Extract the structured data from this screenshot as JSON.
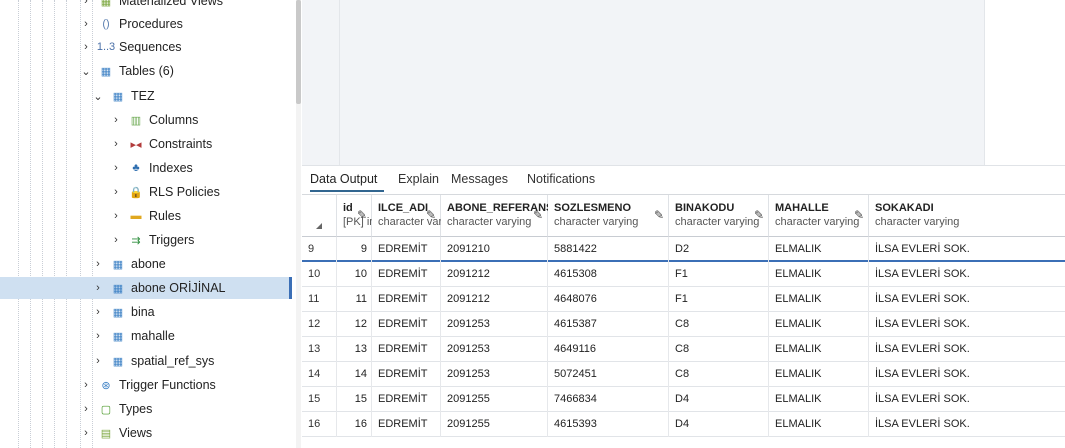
{
  "sidebar": {
    "items": [
      {
        "label": "Materialized Views",
        "chev": "›",
        "icon": "materialized-views-icon",
        "glyph": "▦",
        "color": "#7aa63c"
      },
      {
        "label": "Procedures",
        "chev": "›",
        "icon": "procedures-icon",
        "glyph": "()",
        "color": "#5b7fb0"
      },
      {
        "label": "Sequences",
        "chev": "›",
        "icon": "sequences-icon",
        "glyph": "1..3",
        "color": "#4a70a8"
      },
      {
        "label": "Tables (6)",
        "chev": "⌄",
        "icon": "tables-icon",
        "glyph": "▦",
        "color": "#3a7fc4"
      },
      {
        "label": "TEZ",
        "chev": "⌄",
        "icon": "table-icon",
        "glyph": "▦",
        "color": "#3a7fc4"
      },
      {
        "label": "Columns",
        "chev": "›",
        "icon": "columns-icon",
        "glyph": "▥",
        "color": "#6aa84f"
      },
      {
        "label": "Constraints",
        "chev": "›",
        "icon": "constraints-icon",
        "glyph": "▸◂",
        "color": "#b23b3b"
      },
      {
        "label": "Indexes",
        "chev": "›",
        "icon": "indexes-icon",
        "glyph": "♣",
        "color": "#2f6fb0"
      },
      {
        "label": "RLS Policies",
        "chev": "›",
        "icon": "rls-policies-icon",
        "glyph": "🔒",
        "color": "#4c9a2a"
      },
      {
        "label": "Rules",
        "chev": "›",
        "icon": "rules-icon",
        "glyph": "▬",
        "color": "#e0a820"
      },
      {
        "label": "Triggers",
        "chev": "›",
        "icon": "triggers-icon",
        "glyph": "⇉",
        "color": "#2f8f3f"
      },
      {
        "label": "abone",
        "chev": "›",
        "icon": "table-icon",
        "glyph": "▦",
        "color": "#3a7fc4"
      },
      {
        "label": "abone ORİJİNAL",
        "chev": "›",
        "icon": "table-icon",
        "glyph": "▦",
        "color": "#3a7fc4"
      },
      {
        "label": "bina",
        "chev": "›",
        "icon": "table-icon",
        "glyph": "▦",
        "color": "#3a7fc4"
      },
      {
        "label": "mahalle",
        "chev": "›",
        "icon": "table-icon",
        "glyph": "▦",
        "color": "#3a7fc4"
      },
      {
        "label": "spatial_ref_sys",
        "chev": "›",
        "icon": "table-icon",
        "glyph": "▦",
        "color": "#3a7fc4"
      },
      {
        "label": "Trigger Functions",
        "chev": "›",
        "icon": "trigger-functions-icon",
        "glyph": "⊛",
        "color": "#3a7fc4"
      },
      {
        "label": "Types",
        "chev": "›",
        "icon": "types-icon",
        "glyph": "▢",
        "color": "#4c9a2a"
      },
      {
        "label": "Views",
        "chev": "›",
        "icon": "views-icon",
        "glyph": "▤",
        "color": "#7aa63c"
      }
    ]
  },
  "tabs": [
    "Data Output",
    "Explain",
    "Messages",
    "Notifications"
  ],
  "grid": {
    "columns": [
      {
        "name": "id",
        "type": "[PK] integer"
      },
      {
        "name": "ILCE_ADI",
        "type": "character varying"
      },
      {
        "name": "ABONE_REFERANS_NO",
        "type": "character varying"
      },
      {
        "name": "SOZLESMENO",
        "type": "character varying"
      },
      {
        "name": "BINAKODU",
        "type": "character varying"
      },
      {
        "name": "MAHALLE",
        "type": "character varying"
      },
      {
        "name": "SOKAKADI",
        "type": "character varying"
      }
    ],
    "rows": [
      {
        "rn": "9",
        "cells": [
          "9",
          "EDREMİT",
          "2091210",
          "5881422",
          "D2",
          "ELMALIK",
          "İLSA EVLERİ SOK."
        ]
      },
      {
        "rn": "10",
        "cells": [
          "10",
          "EDREMİT",
          "2091212",
          "4615308",
          "F1",
          "ELMALIK",
          "İLSA EVLERİ SOK."
        ]
      },
      {
        "rn": "11",
        "cells": [
          "11",
          "EDREMİT",
          "2091212",
          "4648076",
          "F1",
          "ELMALIK",
          "İLSA EVLERİ SOK."
        ]
      },
      {
        "rn": "12",
        "cells": [
          "12",
          "EDREMİT",
          "2091253",
          "4615387",
          "C8",
          "ELMALIK",
          "İLSA EVLERİ SOK."
        ]
      },
      {
        "rn": "13",
        "cells": [
          "13",
          "EDREMİT",
          "2091253",
          "4649116",
          "C8",
          "ELMALIK",
          "İLSA EVLERİ SOK."
        ]
      },
      {
        "rn": "14",
        "cells": [
          "14",
          "EDREMİT",
          "2091253",
          "5072451",
          "C8",
          "ELMALIK",
          "İLSA EVLERİ SOK."
        ]
      },
      {
        "rn": "15",
        "cells": [
          "15",
          "EDREMİT",
          "2091255",
          "7466834",
          "D4",
          "ELMALIK",
          "İLSA EVLERİ SOK."
        ]
      },
      {
        "rn": "16",
        "cells": [
          "16",
          "EDREMİT",
          "2091255",
          "4615393",
          "D4",
          "ELMALIK",
          "İLSA EVLERİ SOK."
        ]
      }
    ]
  },
  "colors": {
    "accent": "#326690",
    "selected_bg": "#cfe0f1"
  }
}
